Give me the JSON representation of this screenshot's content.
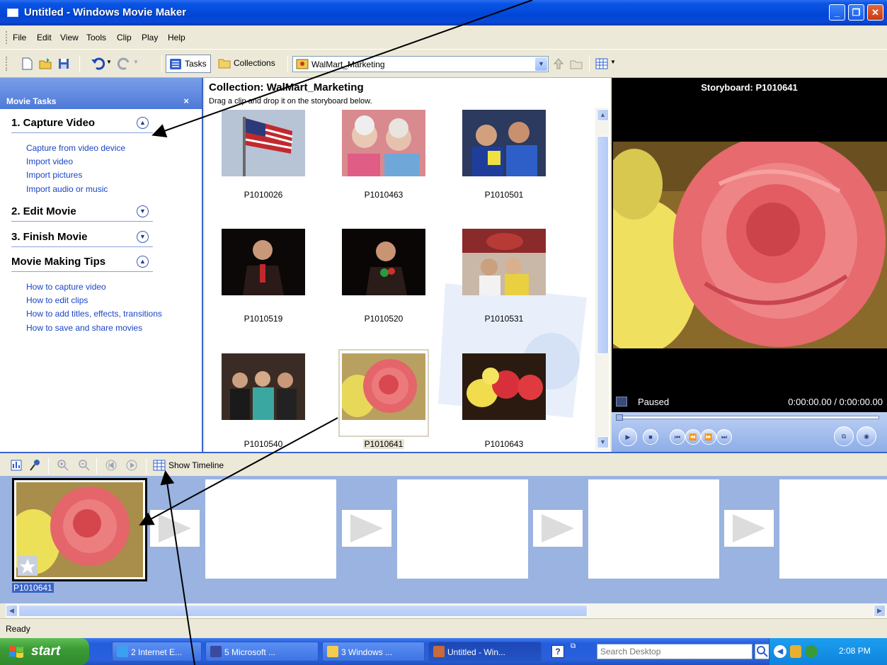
{
  "window": {
    "title": "Untitled - Windows Movie Maker"
  },
  "menu": [
    "File",
    "Edit",
    "View",
    "Tools",
    "Clip",
    "Play",
    "Help"
  ],
  "toolbar": {
    "tasks_label": "Tasks",
    "collections_label": "Collections",
    "collection_select": "WalMart_Marketing"
  },
  "task_pane": {
    "header": "Movie Tasks",
    "close": "×",
    "sections": [
      {
        "title": "1. Capture Video",
        "expanded": true,
        "links": [
          "Capture from video device",
          "Import video",
          "Import pictures",
          "Import audio or music"
        ]
      },
      {
        "title": "2. Edit Movie",
        "expanded": false,
        "links": []
      },
      {
        "title": "3. Finish Movie",
        "expanded": false,
        "links": []
      },
      {
        "title": "Movie Making Tips",
        "expanded": true,
        "links": [
          "How to capture video",
          "How to edit clips",
          "How to add titles, effects, transitions",
          "How to save and share movies"
        ]
      }
    ]
  },
  "collection": {
    "title": "Collection: WalMart_Marketing",
    "subtitle": "Drag a clip and drop it on the storyboard below.",
    "clips": [
      "P1010026",
      "P1010463",
      "P1010501",
      "P1010519",
      "P1010520",
      "P1010531",
      "P1010540",
      "P1010641",
      "P1010643"
    ],
    "selected": "P1010641"
  },
  "monitor": {
    "title": "Storyboard: P1010641",
    "state": "Paused",
    "time": "0:00:00.00 / 0:00:00.00"
  },
  "storyboard": {
    "show_timeline": "Show Timeline",
    "clip_label": "P1010641"
  },
  "status": "Ready",
  "taskbar": {
    "start": "start",
    "tasks": [
      "2 Internet E...",
      "5 Microsoft ...",
      "3 Windows ...",
      "Untitled - Win..."
    ],
    "search_placeholder": "Search Desktop",
    "clock": "2:08 PM"
  },
  "colors": {
    "titlebar": "#0046d6",
    "taskpane_header": "#4d79d8",
    "storyboard_bg": "#9ab3e0",
    "link": "#1a45c4"
  }
}
